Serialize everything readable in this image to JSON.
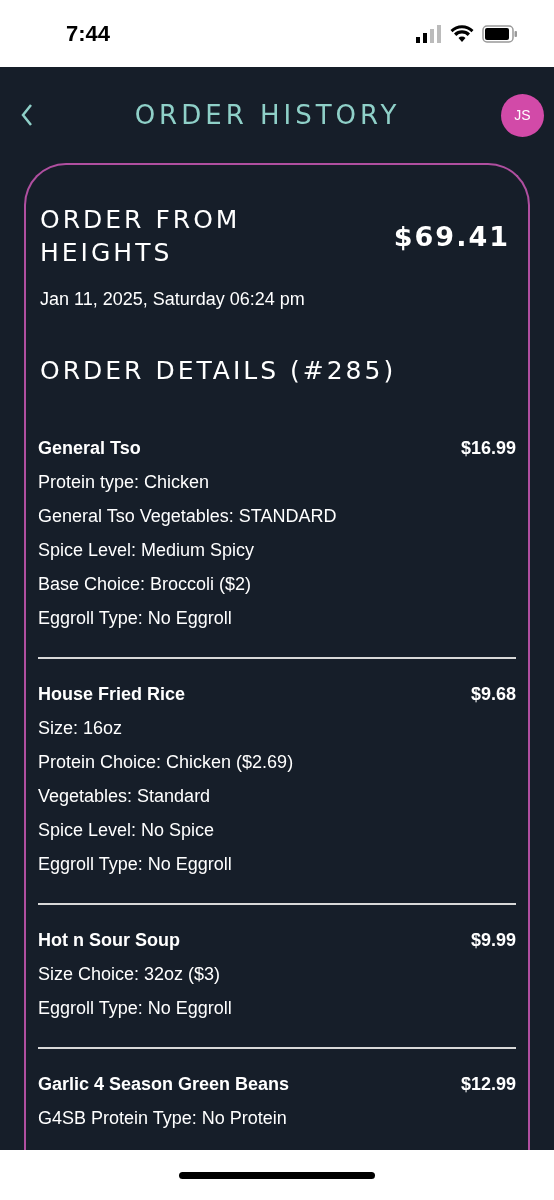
{
  "status_bar": {
    "time": "7:44"
  },
  "header": {
    "title": "ORDER HISTORY",
    "avatar_initials": "JS"
  },
  "order": {
    "title": "ORDER FROM HEIGHTS",
    "total": "$69.41",
    "date": "Jan 11, 2025, Saturday 06:24 pm",
    "details_title": "ORDER DETAILS (#285)",
    "items": [
      {
        "name": "General Tso",
        "price": "$16.99",
        "options": [
          "Protein type: Chicken",
          "General Tso Vegetables: STANDARD",
          "Spice Level: Medium Spicy",
          "Base Choice: Broccoli ($2)",
          "Eggroll Type: No Eggroll"
        ]
      },
      {
        "name": "House Fried Rice",
        "price": "$9.68",
        "options": [
          "Size: 16oz",
          "Protein Choice: Chicken ($2.69)",
          "Vegetables: Standard",
          "Spice Level: No Spice",
          "Eggroll Type: No Eggroll"
        ]
      },
      {
        "name": "Hot n Sour Soup",
        "price": "$9.99",
        "options": [
          "Size Choice: 32oz ($3)",
          "Eggroll Type: No Eggroll"
        ]
      },
      {
        "name": "Garlic 4 Season Green Beans",
        "price": "$12.99",
        "options": [
          "G4SB Protein Type: No Protein"
        ]
      }
    ]
  }
}
